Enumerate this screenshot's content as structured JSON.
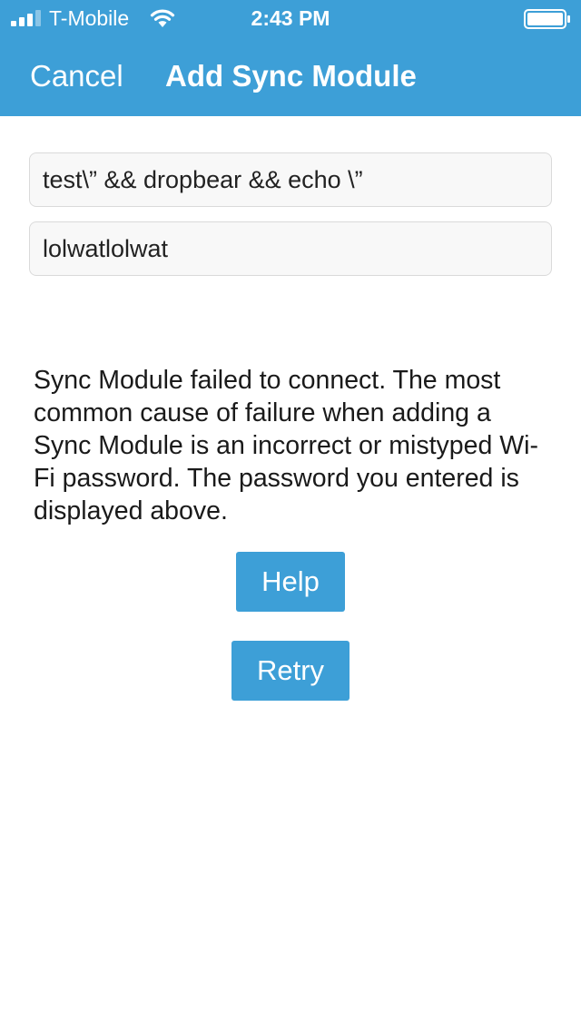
{
  "status_bar": {
    "carrier": "T-Mobile",
    "time": "2:43 PM",
    "signal_bars_active": 3,
    "signal_bars_total": 4,
    "battery_level": 1.0
  },
  "nav": {
    "cancel_label": "Cancel",
    "title": "Add Sync Module"
  },
  "form": {
    "ssid_value": "test\\” && dropbear && echo \\”",
    "password_value": "lolwatlolwat"
  },
  "message": "Sync Module failed to connect. The most common cause of failure when adding a Sync Module is an incorrect or mistyped Wi-Fi password. The password you entered is displayed above.",
  "buttons": {
    "help_label": "Help",
    "retry_label": "Retry"
  },
  "colors": {
    "header_bg": "#3d9fd7",
    "button_bg": "#3d9fd7",
    "text": "#1a1a1a"
  }
}
